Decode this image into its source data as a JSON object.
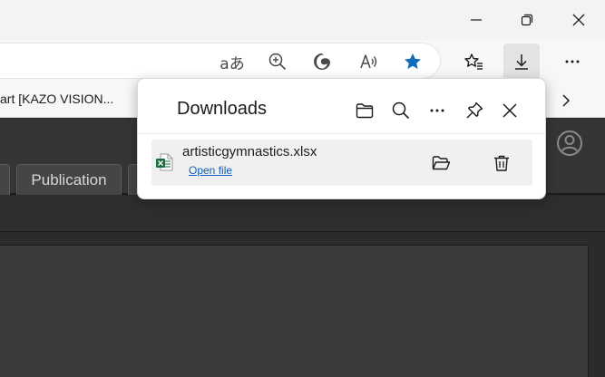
{
  "favorites": {
    "visible_item": "art [KAZO VISION..."
  },
  "page": {
    "tabs": [
      {
        "label": ""
      },
      {
        "label": "Publication"
      }
    ]
  },
  "downloads": {
    "title": "Downloads",
    "items": [
      {
        "file_name": "artisticgymnastics.xlsx",
        "action_label": "Open file",
        "file_type_icon": "excel-file-icon"
      }
    ]
  },
  "toolbar_icons": [
    "read-aloud-translate-icon",
    "zoom-icon",
    "edge-copilot-icon",
    "read-aloud-icon",
    "favorite-star-icon",
    "favorites-collections-icon",
    "downloads-icon",
    "more-icon"
  ],
  "colors": {
    "accent_blue": "#0f6cbd",
    "excel_green": "#1d6f42",
    "link_blue": "#0f5fc0"
  }
}
